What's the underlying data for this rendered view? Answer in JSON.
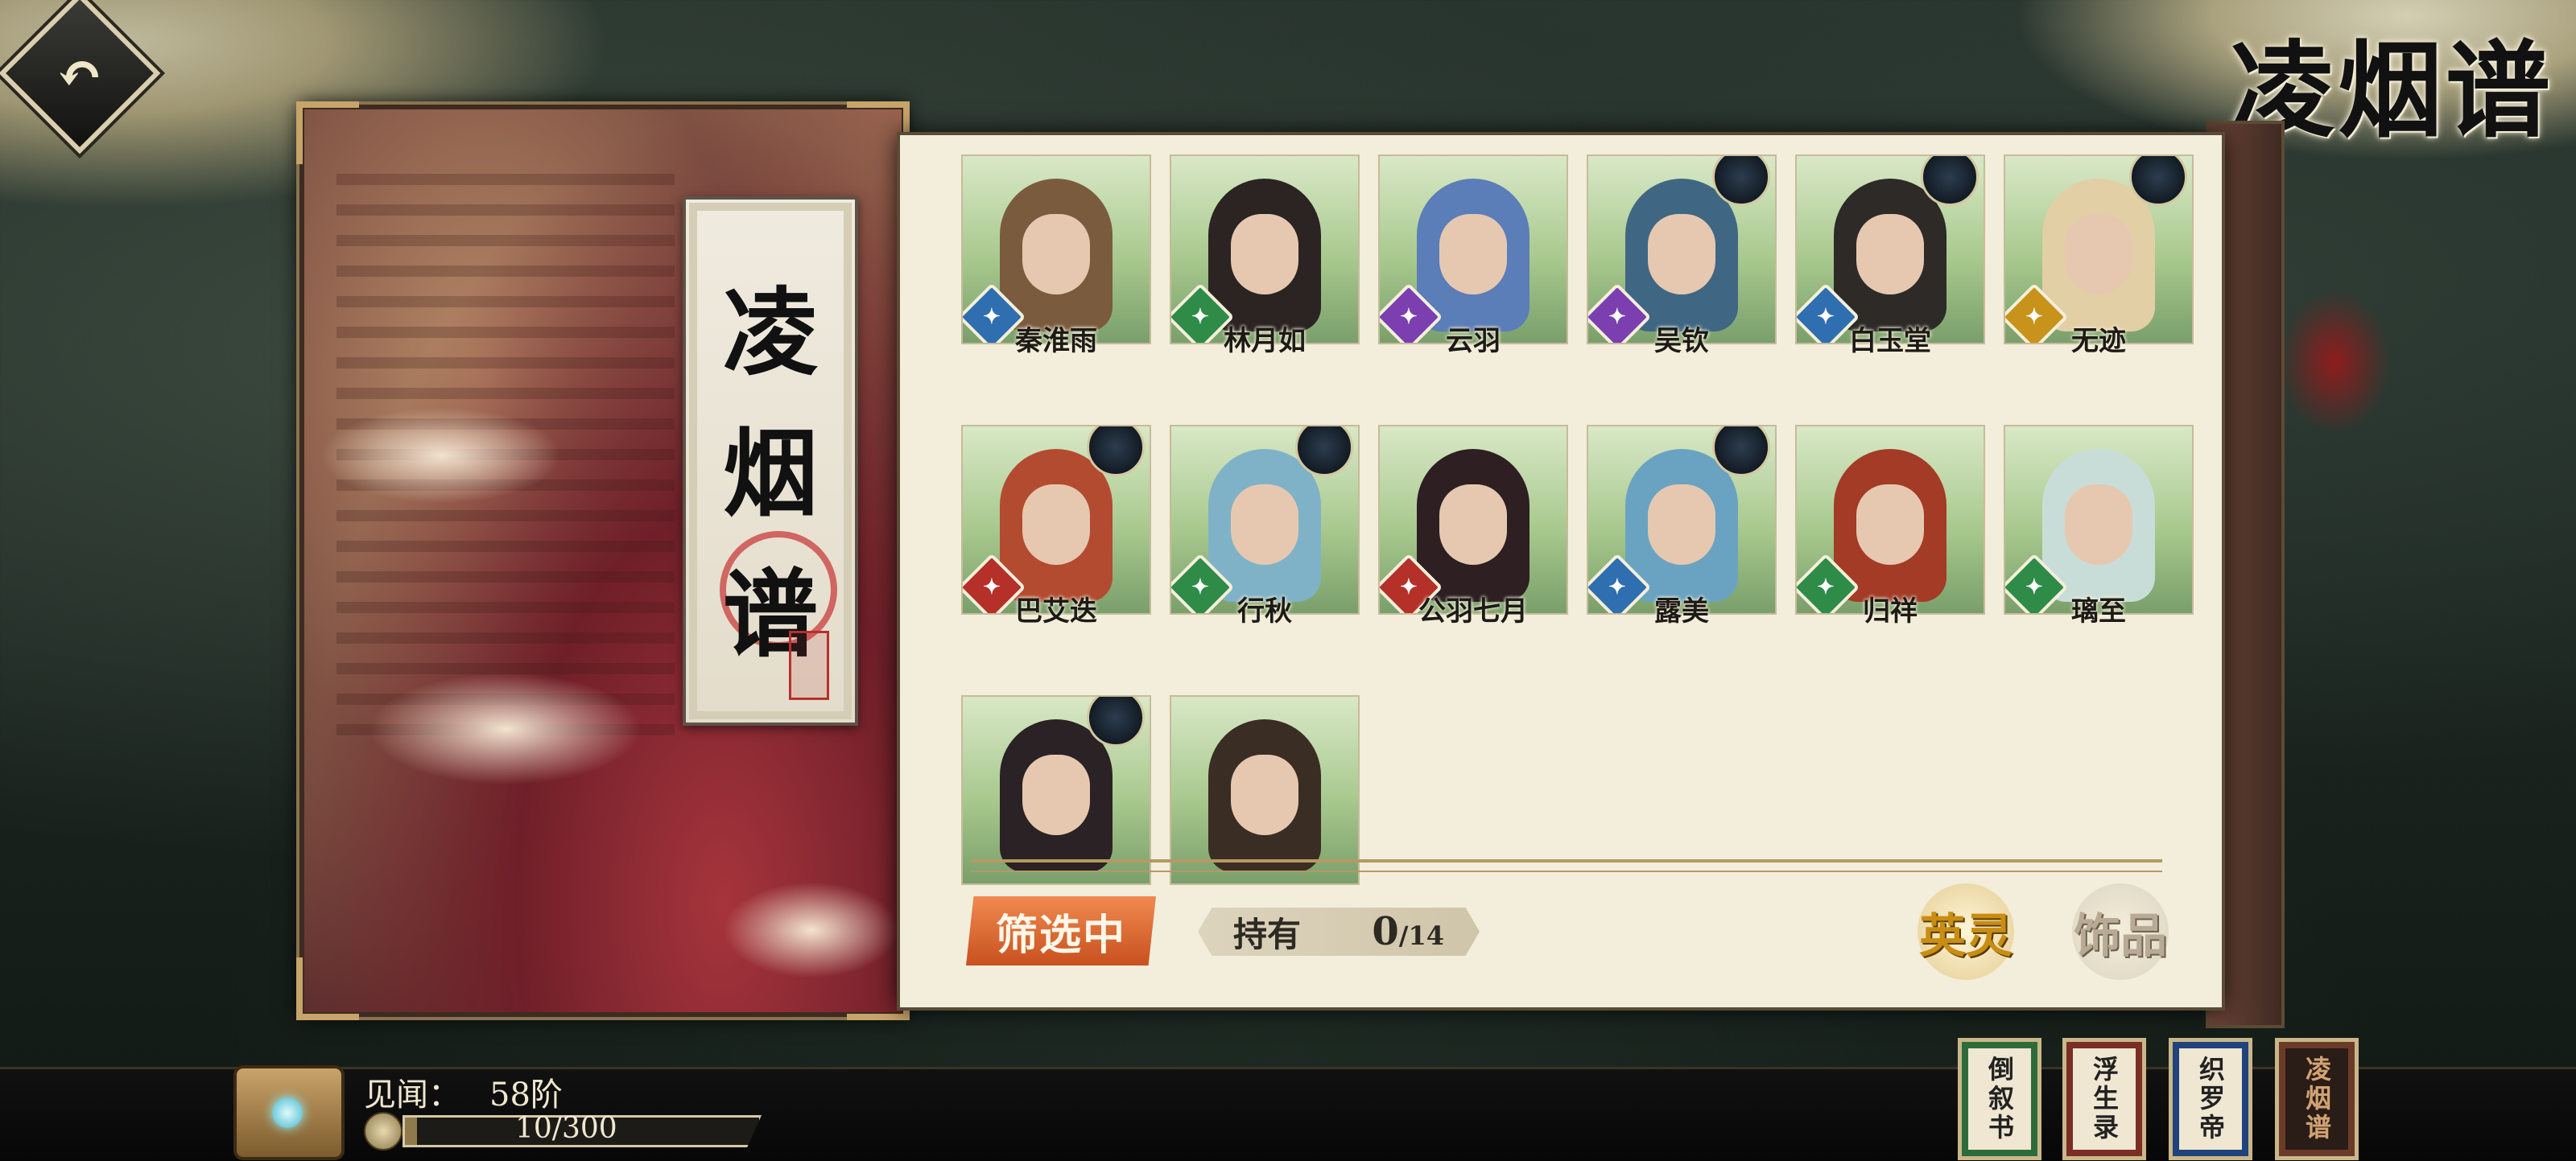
{
  "header": {
    "back_icon": "back-arrow-icon",
    "page_title": "凌烟谱"
  },
  "cover": {
    "title_chars": [
      "凌",
      "烟",
      "谱"
    ]
  },
  "roster": {
    "heroes": [
      {
        "name": "秦淮雨",
        "element": "wind",
        "elem_color": "#2f6fb0",
        "has_emblem": false,
        "bg": "#7b5b3d"
      },
      {
        "name": "林月如",
        "element": "wood",
        "elem_color": "#2e8b48",
        "has_emblem": false,
        "bg": "#2b2422"
      },
      {
        "name": "云羽",
        "element": "thunder",
        "elem_color": "#7b3fb0",
        "has_emblem": false,
        "bg": "#5b7db8"
      },
      {
        "name": "吴钦",
        "element": "thunder",
        "elem_color": "#7b3fb0",
        "has_emblem": true,
        "bg": "#3f6784"
      },
      {
        "name": "白玉堂",
        "element": "wind",
        "elem_color": "#2f6fb0",
        "has_emblem": true,
        "bg": "#2e2a28"
      },
      {
        "name": "无迹",
        "element": "gold",
        "elem_color": "#c7931a",
        "has_emblem": true,
        "bg": "#e3cfa5"
      },
      {
        "name": "巴艾迭",
        "element": "fire",
        "elem_color": "#b53029",
        "has_emblem": true,
        "bg": "#b34b30"
      },
      {
        "name": "行秋",
        "element": "wood",
        "elem_color": "#2e8b48",
        "has_emblem": true,
        "bg": "#7fb2c6"
      },
      {
        "name": "公羽七月",
        "element": "fire",
        "elem_color": "#b53029",
        "has_emblem": false,
        "bg": "#2d1f22"
      },
      {
        "name": "露美",
        "element": "wind",
        "elem_color": "#2f6fb0",
        "has_emblem": true,
        "bg": "#6aa3c2"
      },
      {
        "name": "归祥",
        "element": "wood",
        "elem_color": "#2e8b48",
        "has_emblem": false,
        "bg": "#a33b26"
      },
      {
        "name": "璃至",
        "element": "wood",
        "elem_color": "#2e8b48",
        "has_emblem": false,
        "bg": "#c9ddd8"
      },
      {
        "name": "",
        "element": "",
        "elem_color": "",
        "has_emblem": true,
        "bg": "#2a2224"
      },
      {
        "name": "",
        "element": "",
        "elem_color": "",
        "has_emblem": false,
        "bg": "#3a2d24"
      }
    ],
    "filter_label": "筛选中",
    "owned_label": "持有",
    "owned_count": "0",
    "owned_total": "/14",
    "hero_spirit_label": "英灵",
    "accessory_label": "饰品"
  },
  "footer": {
    "level_label": "见闻：",
    "level_value": "58阶",
    "exp_text": "10/300",
    "exp_fraction": 0.033,
    "tabs": [
      "倒叙书",
      "浮生录",
      "织罗帝",
      "凌烟谱"
    ]
  }
}
